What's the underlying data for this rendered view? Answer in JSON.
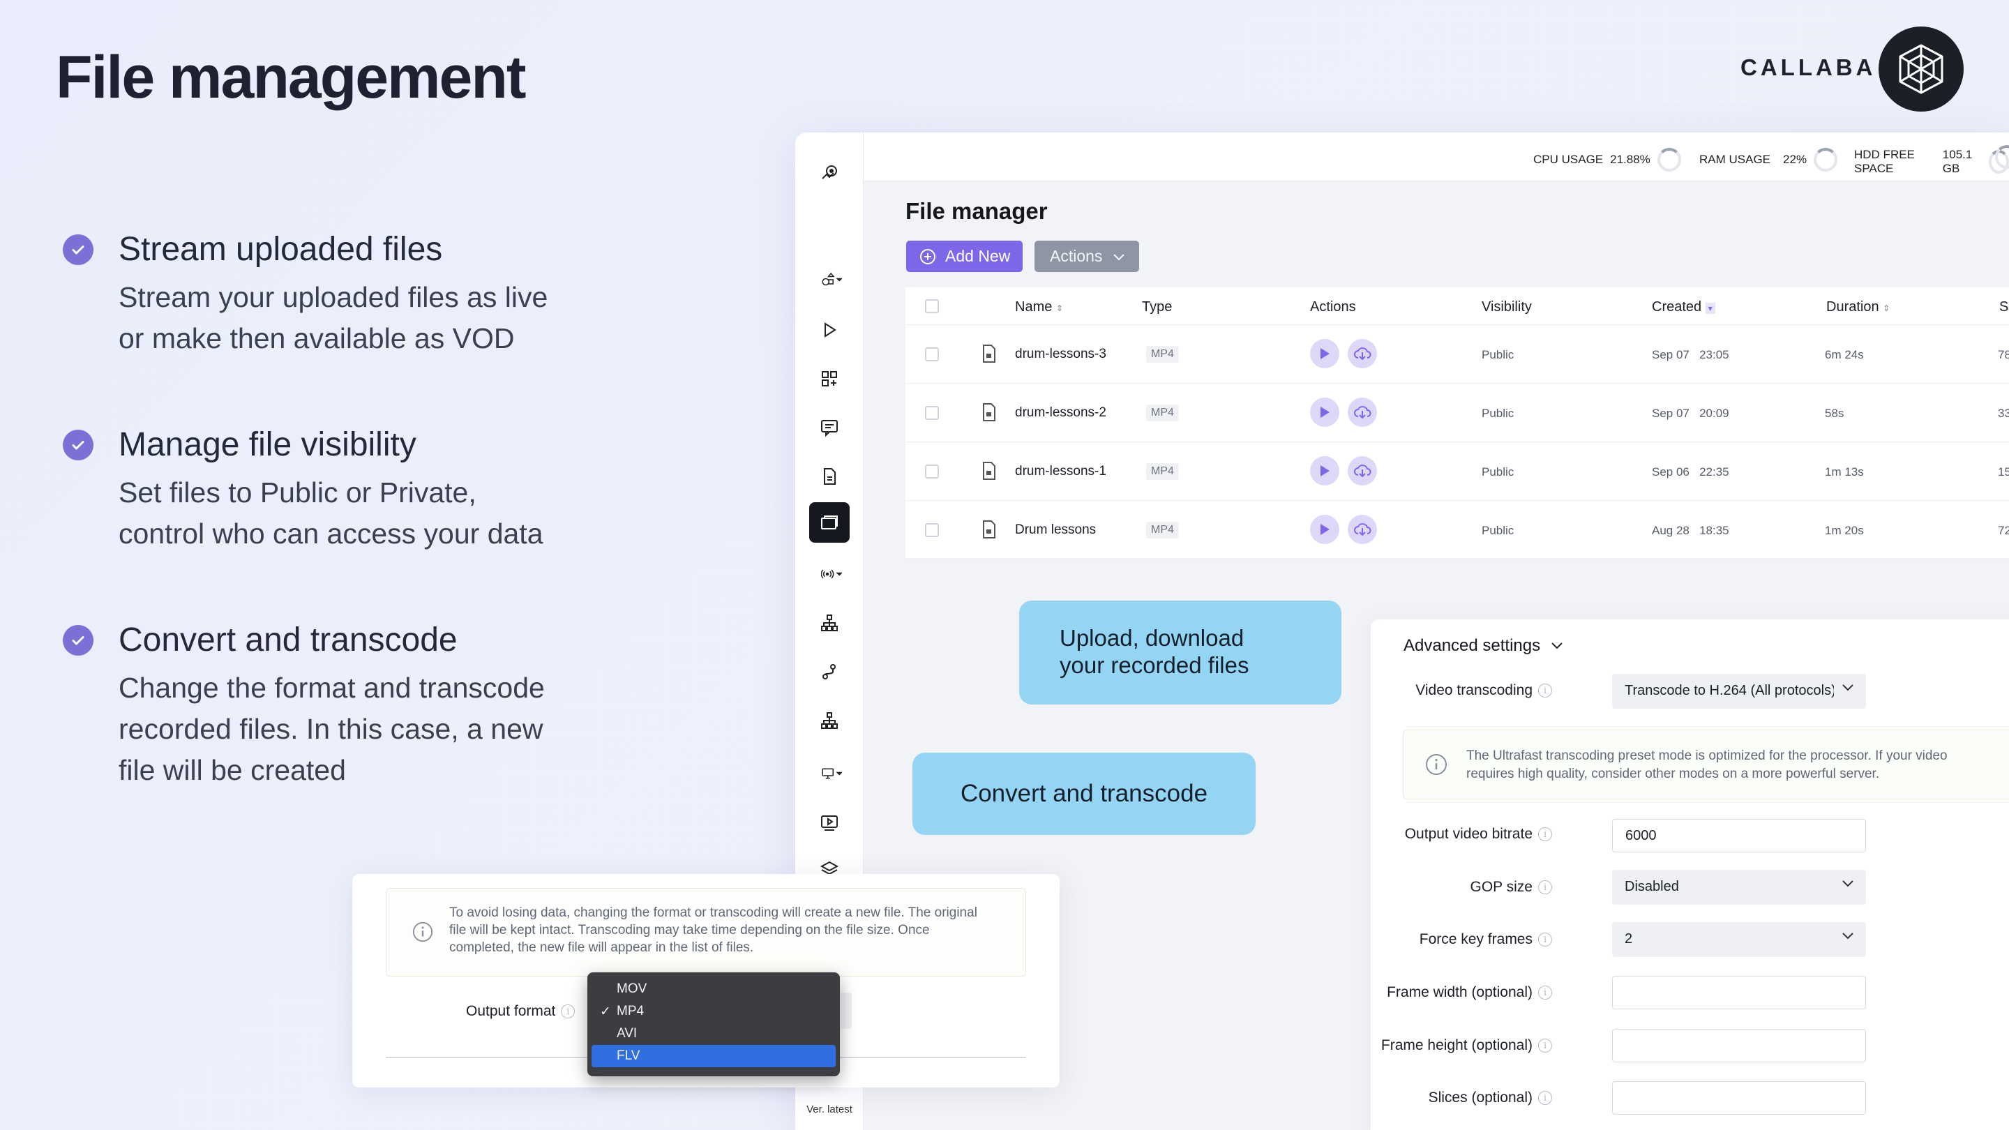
{
  "page_title": "File management",
  "brand": {
    "name": "CALLABA"
  },
  "features": [
    {
      "title": "Stream uploaded files",
      "text_line1": "Stream your uploaded files as live",
      "text_line2": "or make then available as VOD",
      "text_line3": ""
    },
    {
      "title": "Manage file visibility",
      "text_line1": "Set files to Public or Private,",
      "text_line2": "control who can access your data",
      "text_line3": ""
    },
    {
      "title": "Convert and transcode",
      "text_line1": "Change the format and transcode",
      "text_line2": "recorded files. In this case, a new",
      "text_line3": "file will be created"
    }
  ],
  "topbar": {
    "cpu_label": "CPU USAGE",
    "cpu_value": "21.88%",
    "ram_label": "RAM USAGE",
    "ram_value": "22%",
    "hdd_label": "HDD FREE SPACE",
    "hdd_value": "105.1 GB"
  },
  "sidebar": {
    "version": "Ver. latest"
  },
  "file_manager": {
    "title": "File manager",
    "add_new": "Add New",
    "actions": "Actions",
    "columns": [
      "Name",
      "Type",
      "Actions",
      "Visibility",
      "Created",
      "Duration",
      "Si"
    ],
    "rows": [
      {
        "name": "drum-lessons-3",
        "type": "MP4",
        "visibility": "Public",
        "date": "Sep 07",
        "time": "23:05",
        "duration": "6m 24s",
        "size": "78"
      },
      {
        "name": "drum-lessons-2",
        "type": "MP4",
        "visibility": "Public",
        "date": "Sep 07",
        "time": "20:09",
        "duration": "58s",
        "size": "33"
      },
      {
        "name": "drum-lessons-1",
        "type": "MP4",
        "visibility": "Public",
        "date": "Sep 06",
        "time": "22:35",
        "duration": "1m 13s",
        "size": "15"
      },
      {
        "name": "Drum lessons",
        "type": "MP4",
        "visibility": "Public",
        "date": "Aug 28",
        "time": "18:35",
        "duration": "1m 20s",
        "size": "72"
      }
    ]
  },
  "callouts": {
    "upload_line1": "Upload, download",
    "upload_line2": "your recorded files",
    "convert": "Convert and transcode"
  },
  "advanced": {
    "title": "Advanced settings",
    "video_transcoding_label": "Video transcoding",
    "video_transcoding_value": "Transcode to H.264 (All protocols)",
    "notice_line1": "The Ultrafast transcoding preset mode is optimized for the processor. If your video",
    "notice_line2": "requires high quality, consider other modes on a more powerful server.",
    "bitrate_label": "Output video bitrate",
    "bitrate_value": "6000",
    "gop_label": "GOP size",
    "gop_value": "Disabled",
    "force_label": "Force key frames",
    "force_value": "2",
    "width_label": "Frame width (optional)",
    "width_value": "",
    "height_label": "Frame height (optional)",
    "height_value": "",
    "slices_label": "Slices (optional)",
    "slices_value": ""
  },
  "dialog": {
    "notice_line1": "To avoid losing data, changing the format or transcoding will create a new file. The original",
    "notice_line2": "file will be kept intact. Transcoding may take time depending on the file size. Once",
    "notice_line3": "completed, the new file will appear in the list of files.",
    "output_label": "Output format",
    "options": [
      "MOV",
      "MP4",
      "AVI",
      "FLV"
    ],
    "checked": "MP4",
    "highlighted": "FLV"
  },
  "colors": {
    "accent": "#7b68e8",
    "callout": "#95d5f4",
    "check": "#7c6fd6",
    "menu_highlight": "#2f6fe0"
  }
}
